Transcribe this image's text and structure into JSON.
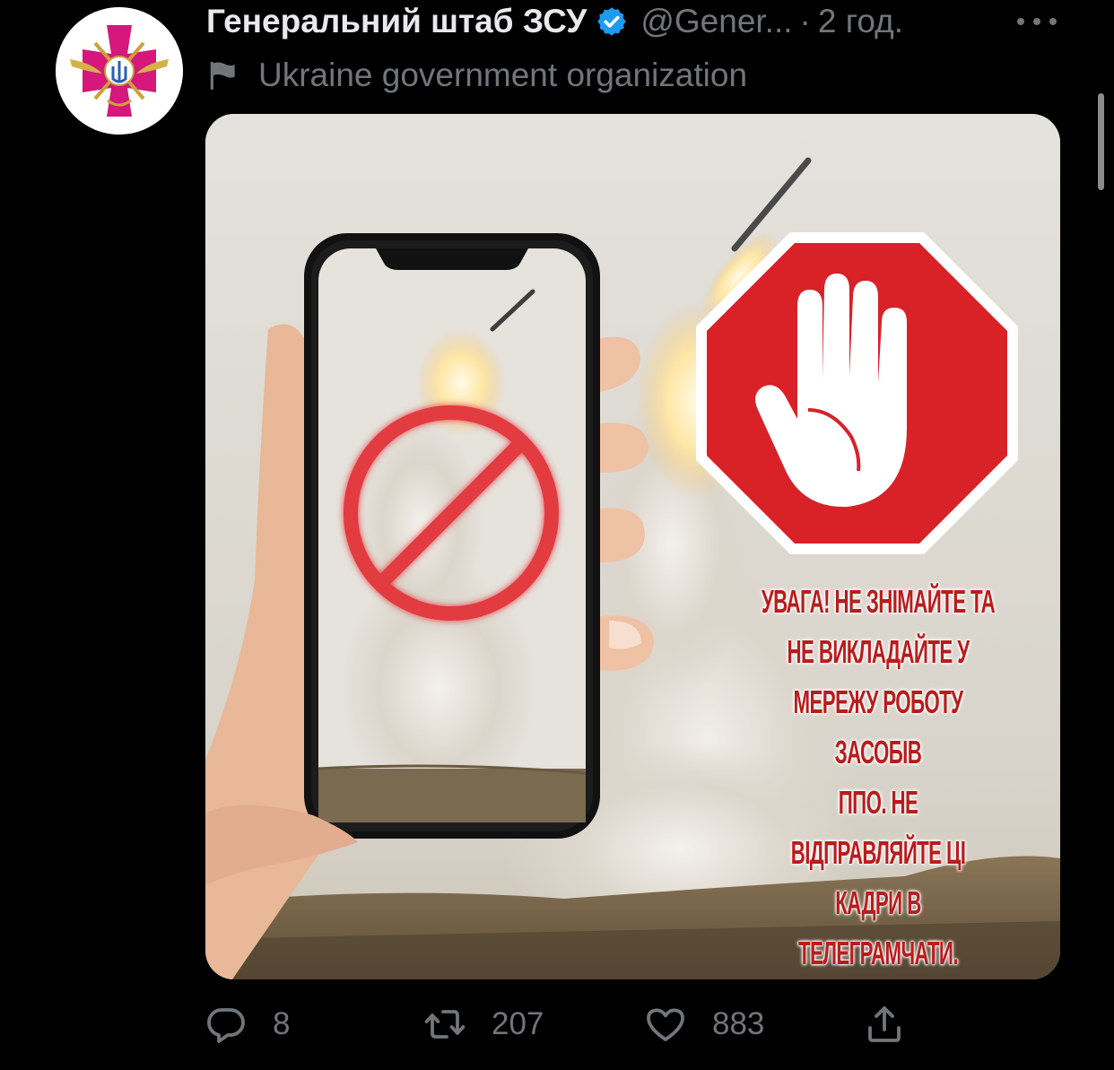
{
  "tweet": {
    "author_name": "Генеральний штаб ЗСУ",
    "handle": "@Gener...",
    "separator": "·",
    "time": "2 год.",
    "label": "Ukraine government organization",
    "media": {
      "warning_lines": [
        "УВАГА! НЕ ЗНІМАЙТЕ ТА",
        "НЕ ВИКЛАДАЙТЕ У",
        "МЕРЕЖУ РОБОТУ ЗАСОБІВ",
        "ППО. НЕ ВІДПРАВЛЯЙТЕ ЦІ",
        "КАДРИ В ТЕЛЕГРАМЧАТИ."
      ]
    },
    "actions": {
      "replies": "8",
      "retweets": "207",
      "likes": "883"
    }
  },
  "colors": {
    "background": "#000000",
    "text_primary": "#e7e9ea",
    "text_secondary": "#71767b",
    "verified": "#1d9bf0",
    "stop_red": "#d92128",
    "emblem_magenta": "#d6177b"
  },
  "icons": {
    "verified": "verified-badge-icon",
    "label": "flag-icon",
    "more": "more-dots-icon",
    "reply": "reply-icon",
    "retweet": "retweet-icon",
    "like": "heart-icon",
    "share": "share-icon"
  }
}
